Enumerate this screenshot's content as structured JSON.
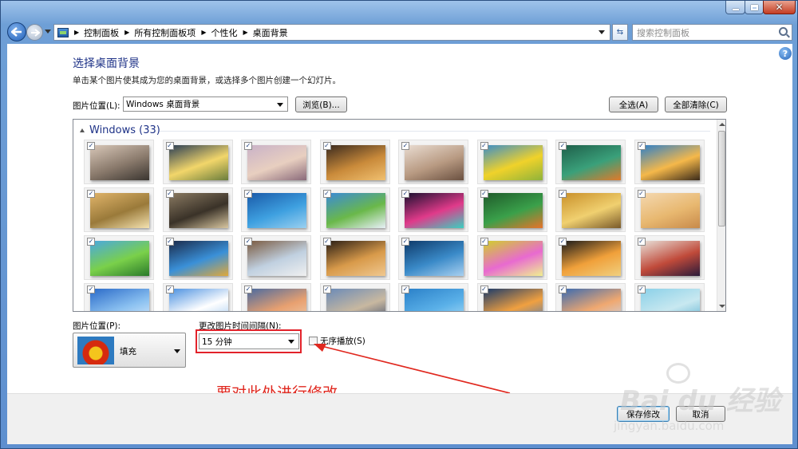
{
  "window": {
    "caption_min": "─",
    "caption_max": "□",
    "caption_close": "✕"
  },
  "address": {
    "crumbs": [
      "控制面板",
      "所有控制面板项",
      "个性化",
      "桌面背景"
    ],
    "search_placeholder": "搜索控制面板"
  },
  "help_label": "?",
  "header": {
    "title": "选择桌面背景",
    "description": "单击某个图片使其成为您的桌面背景，或选择多个图片创建一个幻灯片。"
  },
  "location": {
    "label": "图片位置(L):",
    "value": "Windows 桌面背景",
    "browse_label": "浏览(B)...",
    "select_all_label": "全选(A)",
    "clear_all_label": "全部清除(C)"
  },
  "gallery": {
    "group_label": "Windows (33)",
    "check_mark": "✓",
    "thumbnails": [
      {
        "colors": [
          "#d8c7b8",
          "#8a7a6c",
          "#3a3530"
        ]
      },
      {
        "colors": [
          "#2a3d55",
          "#f2d66a",
          "#6a7d3c"
        ]
      },
      {
        "colors": [
          "#c9b2c8",
          "#e8cfc0",
          "#8a6a7a"
        ]
      },
      {
        "colors": [
          "#3a2a1e",
          "#c98a3a",
          "#f0c070"
        ]
      },
      {
        "colors": [
          "#e9dcd1",
          "#b89a82",
          "#6a5040"
        ]
      },
      {
        "colors": [
          "#3c8ec9",
          "#f0d22a",
          "#8fb33a"
        ]
      },
      {
        "colors": [
          "#1f5f4a",
          "#3aa07a",
          "#e07a2a"
        ]
      },
      {
        "colors": [
          "#2d7fc9",
          "#f5b84a",
          "#3a2a1a"
        ]
      },
      {
        "colors": [
          "#e0b46a",
          "#9a7a3a",
          "#f4e2b0"
        ]
      },
      {
        "colors": [
          "#8a7a62",
          "#3a3228",
          "#d8c6a0"
        ]
      },
      {
        "colors": [
          "#1a5aa8",
          "#3ea0e0",
          "#9ad0f0"
        ]
      },
      {
        "colors": [
          "#3a8ad8",
          "#6ab84a",
          "#e8f0f8"
        ]
      },
      {
        "colors": [
          "#1a1030",
          "#e03a8a",
          "#3ad0c0"
        ]
      },
      {
        "colors": [
          "#1f5a2a",
          "#3aa04a",
          "#e8732a"
        ]
      },
      {
        "colors": [
          "#c9902a",
          "#f0d070",
          "#7a5a2a"
        ]
      },
      {
        "colors": [
          "#f4d8b0",
          "#e8b870",
          "#c88a4a"
        ]
      },
      {
        "colors": [
          "#4aa8e0",
          "#7ad04a",
          "#2a7a2a"
        ]
      },
      {
        "colors": [
          "#1a2a4a",
          "#3a90d8",
          "#e0a83a"
        ]
      },
      {
        "colors": [
          "#7a5a40",
          "#c0d0e0",
          "#f0f0f0"
        ]
      },
      {
        "colors": [
          "#2a1e14",
          "#d89a4a",
          "#f0c890"
        ]
      },
      {
        "colors": [
          "#0e3a6a",
          "#3a8ac8",
          "#a8d0f0"
        ]
      },
      {
        "colors": [
          "#d0d02a",
          "#e86ad0",
          "#f0f090"
        ]
      },
      {
        "colors": [
          "#1a1a1a",
          "#f0a03a",
          "#f0d080"
        ]
      },
      {
        "colors": [
          "#e8e0d8",
          "#c04a3a",
          "#2a1a3a"
        ]
      },
      {
        "colors": [
          "#2a6ac8",
          "#8ac0f0",
          "#e0f0ff"
        ]
      },
      {
        "colors": [
          "#4a90e0",
          "#ffffff",
          "#a0c8f0"
        ]
      },
      {
        "colors": [
          "#4a6aa0",
          "#e8a070",
          "#f0d0b0"
        ]
      },
      {
        "colors": [
          "#6a8ab8",
          "#c8b8a0",
          "#3a4a6a"
        ]
      },
      {
        "colors": [
          "#2a80c8",
          "#5ab0e8",
          "#b0e0f8"
        ]
      },
      {
        "colors": [
          "#1a3a6a",
          "#f0a040",
          "#4a7ab8"
        ]
      },
      {
        "colors": [
          "#3a6ab0",
          "#f0a870",
          "#c8d8f0"
        ]
      },
      {
        "colors": [
          "#8ad0e8",
          "#c8e8f0",
          "#5ab0d0"
        ]
      }
    ]
  },
  "position": {
    "label": "图片位置(P):",
    "value": "填充"
  },
  "interval": {
    "label": "更改图片时间间隔(N):",
    "value": "15 分钟",
    "shuffle_label": "无序播放(S)"
  },
  "annotation": {
    "text": "要对此处进行修改",
    "color": "#e0281f"
  },
  "footer": {
    "save_label": "保存修改",
    "cancel_label": "取消"
  },
  "watermark": {
    "brand": "Bai du 经验",
    "url": "jingyan.baidu.com"
  }
}
